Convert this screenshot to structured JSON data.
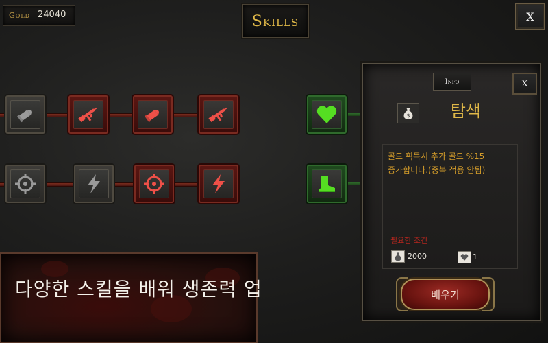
{
  "gold": {
    "label": "Gold",
    "value": "24040"
  },
  "title": "Skills",
  "close_label": "X",
  "skill_tree": {
    "row1": [
      {
        "icon": "bullet-icon",
        "state": "locked"
      },
      {
        "icon": "rifle-icon",
        "state": "red"
      },
      {
        "icon": "bullet-icon",
        "state": "red"
      },
      {
        "icon": "rifle-icon",
        "state": "red"
      }
    ],
    "row2": [
      {
        "icon": "crosshair-icon",
        "state": "locked"
      },
      {
        "icon": "lightning-icon",
        "state": "locked"
      },
      {
        "icon": "crosshair-icon",
        "state": "red"
      },
      {
        "icon": "lightning-icon",
        "state": "red"
      }
    ],
    "green": [
      {
        "icon": "heart-icon",
        "state": "green"
      },
      {
        "icon": "boot-icon",
        "state": "green"
      }
    ]
  },
  "info_panel": {
    "tab_label": "Info",
    "close_label": "X",
    "icon": "money-bag-icon",
    "skill_name": "탐색",
    "description_line1": "골드 획득시 추가 골드 %15",
    "description_line2": "증가합니다.(중복 적용 안됨)",
    "requirement_label": "필요한 조건",
    "requirements": [
      {
        "icon": "money-bag-icon",
        "value": "2000"
      },
      {
        "icon": "heart-icon",
        "value": "1"
      }
    ],
    "learn_button": "배우기"
  },
  "banner_text": "다양한 스킬을 배워 생존력 업",
  "colors": {
    "accent_gold": "#e0b848",
    "red_icon": "#ee5048",
    "green_icon": "#55dd22",
    "gray_icon": "#9a9a9a"
  }
}
